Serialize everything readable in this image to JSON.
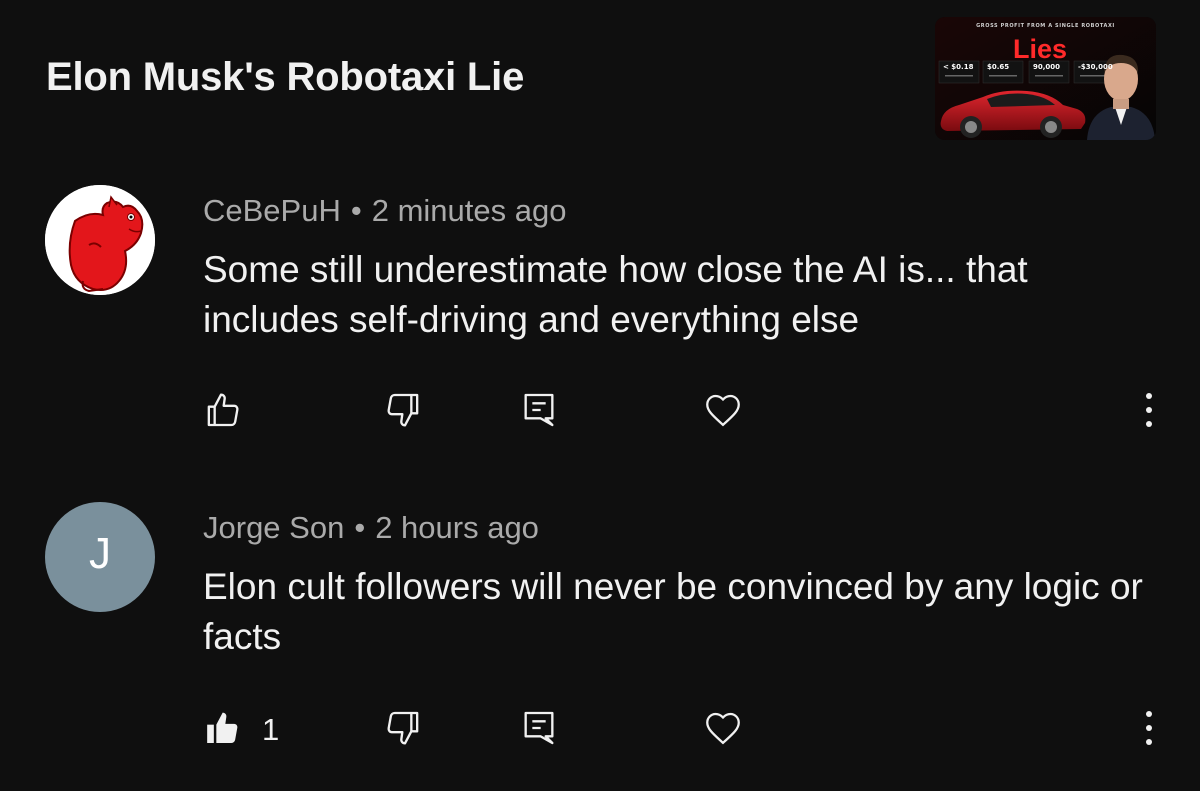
{
  "video": {
    "title": "Elon Musk's Robotaxi Lie",
    "thumbnail": {
      "heading": "GROSS PROFIT FROM A SINGLE ROBOTAXI",
      "overlay_word": "Lies",
      "values": [
        "< $0.18",
        "$0.65",
        "90,000",
        "-$30,000"
      ]
    }
  },
  "comments": [
    {
      "author": "CeBePuH",
      "separator": "•",
      "time": "2 minutes ago",
      "text": "Some still underestimate how close the AI is... that includes self-driving and everything else",
      "avatar_icon": "red-cartoon-creature-avatar",
      "likes": "",
      "liked": false
    },
    {
      "author": "Jorge Son",
      "separator": "•",
      "time": "2 hours ago",
      "text": "Elon cult followers will never be convinced by any logic or facts",
      "avatar_letter": "J",
      "avatar_color": "#7a909c",
      "likes": "1",
      "liked": true
    }
  ],
  "icons": {
    "like": "thumbs-up-icon",
    "dislike": "thumbs-down-icon",
    "reply": "reply-comment-icon",
    "heart": "heart-icon",
    "more": "more-vertical-icon"
  },
  "colors": {
    "background": "#0f0f0f",
    "text_primary": "#f1f1f1",
    "text_secondary": "#aaaaaa"
  }
}
